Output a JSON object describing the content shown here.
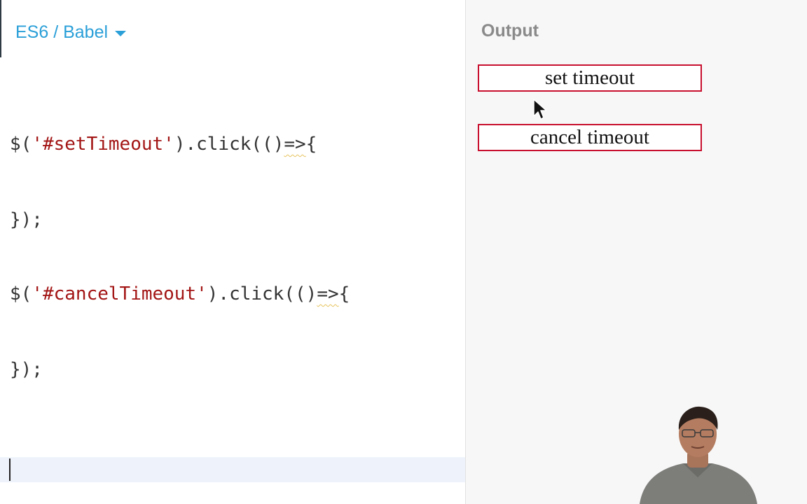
{
  "editor": {
    "language_label": "ES6 / Babel",
    "code_lines": [
      {
        "prefix": "$(",
        "string": "'#setTimeout'",
        "middle": ").click(()",
        "squiggle": "=>",
        "suffix": "{"
      },
      {
        "text": "});"
      },
      {
        "prefix": "$(",
        "string": "'#cancelTimeout'",
        "middle": ").click(()",
        "squiggle": "=>",
        "suffix": "{"
      },
      {
        "text": "});"
      }
    ]
  },
  "output": {
    "title": "Output",
    "buttons": [
      {
        "label": "set timeout"
      },
      {
        "label": "cancel timeout"
      }
    ]
  },
  "icons": {
    "language_dropdown": "chevron-down-icon",
    "mouse_pointer": "mouse-pointer-icon"
  },
  "colors": {
    "accent": "#2a9fd8",
    "string": "#a31515",
    "button_border": "#c8102e",
    "output_bg": "#f7f7f7"
  }
}
